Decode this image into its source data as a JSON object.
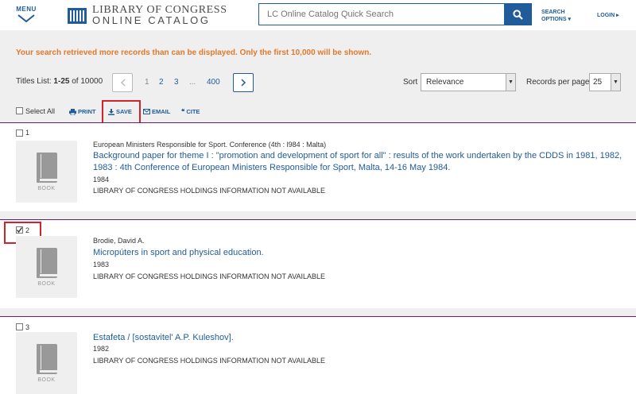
{
  "header": {
    "menu_label": "MENU",
    "logo_line1": "LIBRARY OF CONGRESS",
    "logo_line2": "ONLINE CATALOG",
    "search_placeholder": "LC Online Catalog Quick Search",
    "search_options_line1": "SEARCH",
    "search_options_line2": "OPTIONS ▾",
    "login_label": "LOGIN ▸"
  },
  "notice": "Your search retrieved more records than can be displayed. Only the first 10,000 will be shown.",
  "results": {
    "titles_list_prefix": "Titles List: ",
    "titles_list_range": "1-25",
    "titles_list_suffix": " of 10000",
    "pagination": {
      "prev_icon": "chevron-left-icon",
      "pages": [
        "1",
        "2",
        "3",
        "...",
        "400"
      ],
      "current_page": "1",
      "next_icon": "chevron-right-icon"
    },
    "sort_label": "Sort",
    "sort_value": "Relevance",
    "rpp_label": "Records per page",
    "rpp_value": "25"
  },
  "toolbar": {
    "select_all": "Select All",
    "print": "PRINT",
    "save": "SAVE",
    "email": "EMAIL",
    "cite": "CITE"
  },
  "records": [
    {
      "number": "1",
      "checked": false,
      "author": "European Ministers Responsible for Sport. Conference (4th : l984 : Malta)",
      "title": "Background paper for theme I : \"promotion and development of sport for all\" : results of the work undertaken by the CDDS in 1981, 1982, 1983 : 4th Conference of European Ministers Responsible for Sport, Malta, 14-16 May 1984.",
      "date": "1984",
      "holdings": "LIBRARY OF CONGRESS HOLDINGS INFORMATION NOT AVAILABLE",
      "format": "BOOK"
    },
    {
      "number": "2",
      "checked": true,
      "author": "Brodie, David A.",
      "title": "Micropúters in sport and physical education.",
      "date": "1983",
      "holdings": "LIBRARY OF CONGRESS HOLDINGS INFORMATION NOT AVAILABLE",
      "format": "BOOK"
    },
    {
      "number": "3",
      "checked": false,
      "author": "",
      "title": "Estafeta / [sostavitel' A.P. Kuleshov].",
      "date": "1982",
      "holdings": "LIBRARY OF CONGRESS HOLDINGS INFORMATION NOT AVAILABLE",
      "format": "BOOK"
    }
  ],
  "colors": {
    "brand_blue": "#1f5c99",
    "notice_orange": "#e0792b",
    "highlight_red": "#d0232a",
    "divider_purple": "#6a1f6e"
  }
}
